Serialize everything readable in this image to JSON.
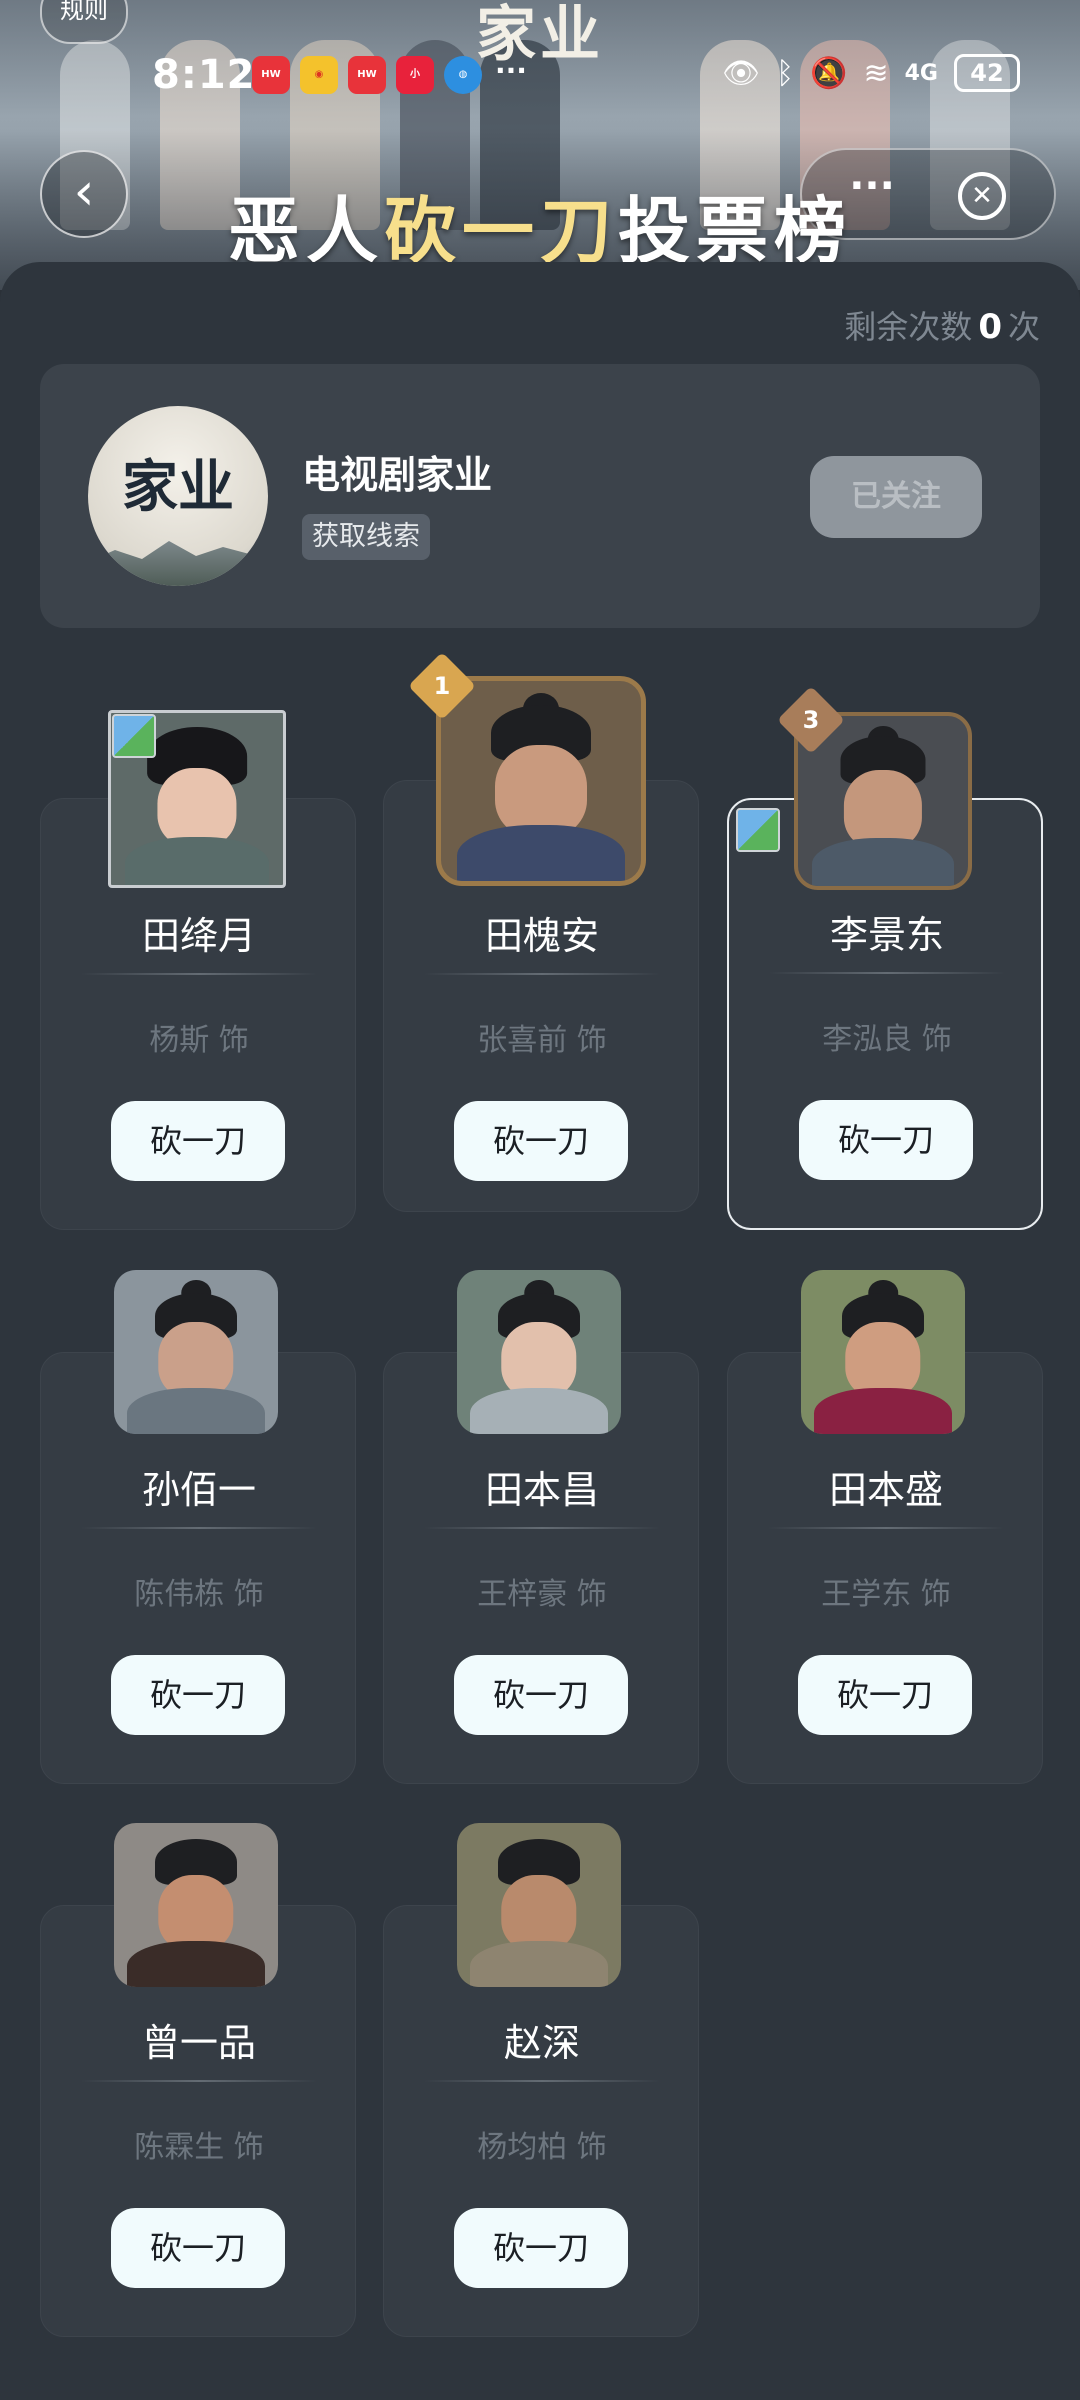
{
  "status_bar": {
    "time": "8:12",
    "signal": "4G",
    "battery": "42"
  },
  "banner": {
    "rule_label": "规则",
    "show_title": "家业",
    "title_prefix": "恶人",
    "title_highlight": "砍一刀",
    "title_suffix": "投票榜"
  },
  "remaining": {
    "label": "剩余次数",
    "count": "0",
    "unit": "次"
  },
  "show": {
    "name": "电视剧家业",
    "logo_text": "家业",
    "clue_label": "获取线索",
    "follow_label": "已关注"
  },
  "cut_label": "砍一刀",
  "characters": [
    {
      "name": "田绛月",
      "actor": "杨斯 饰"
    },
    {
      "name": "田槐安",
      "actor": "张喜前 饰",
      "rank": "1"
    },
    {
      "name": "李景东",
      "actor": "李泓良 饰",
      "rank": "3"
    },
    {
      "name": "孙佰一",
      "actor": "陈伟栋 饰"
    },
    {
      "name": "田本昌",
      "actor": "王梓豪 饰"
    },
    {
      "name": "田本盛",
      "actor": "王学东 饰"
    },
    {
      "name": "曾一品",
      "actor": "陈霖生 饰"
    },
    {
      "name": "赵深",
      "actor": "杨均柏 饰"
    }
  ],
  "colors": {
    "panel": "#2e353d",
    "card": "#353c44",
    "button": "#f1fbfd",
    "highlight": "#f7df8c",
    "gold_badge": "#d9a650",
    "bronze_badge": "#a87d5a"
  }
}
